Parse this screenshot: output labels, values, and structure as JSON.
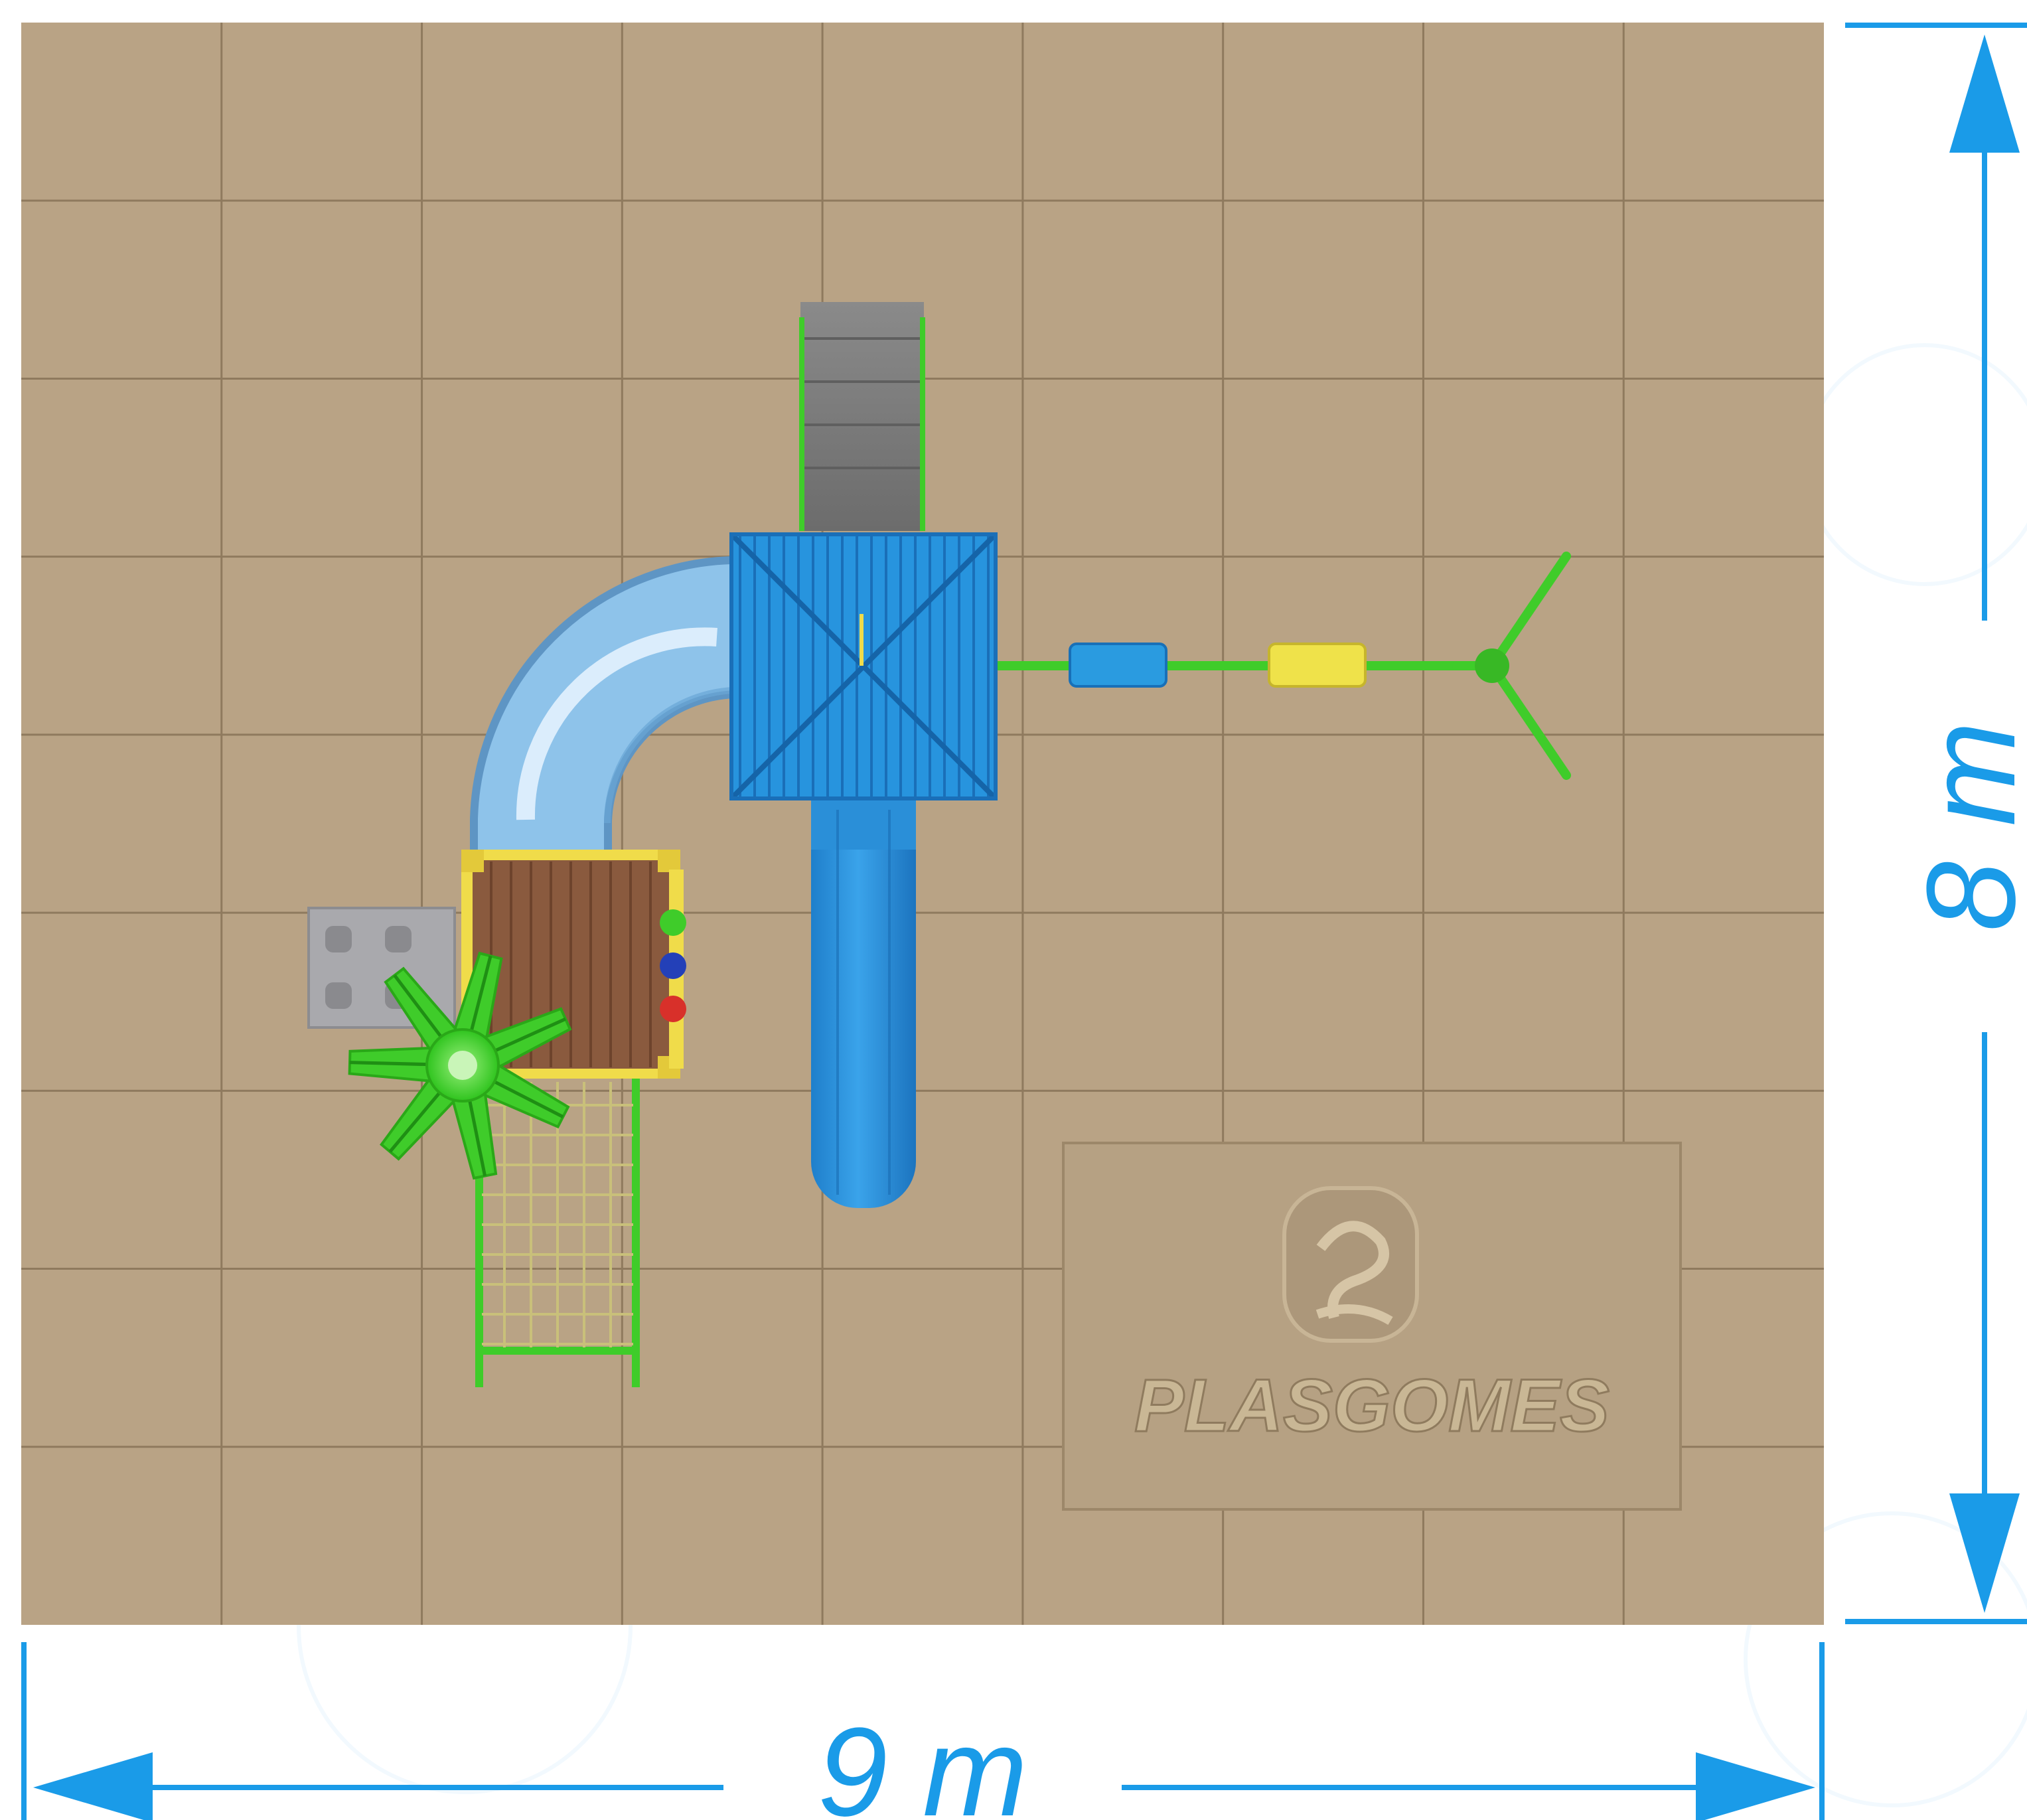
{
  "dimensions": {
    "width_label": "9 m",
    "height_label": "8 m",
    "grid_columns": 9,
    "grid_rows": 8
  },
  "brand": {
    "name": "PLASGOMES",
    "logo_icon": "plasgomes-mascot-logo-icon"
  },
  "colors": {
    "background": "#ffffff",
    "floor": "#b9a385",
    "floor_grid": "#8f7a5e",
    "dimension": "#1a9be8",
    "roof": "#2794de",
    "slide": "#2a8fd8",
    "tube": "#8ec3ea",
    "frame_green": "#3fcc2a",
    "deck_wood": "#8a5a3e",
    "trim_yellow": "#f0dc4a",
    "stair_grey": "#7d7d7d",
    "block_grey": "#a9a9ad",
    "seat_blue": "#2a9be0",
    "seat_yellow": "#efe24a"
  }
}
